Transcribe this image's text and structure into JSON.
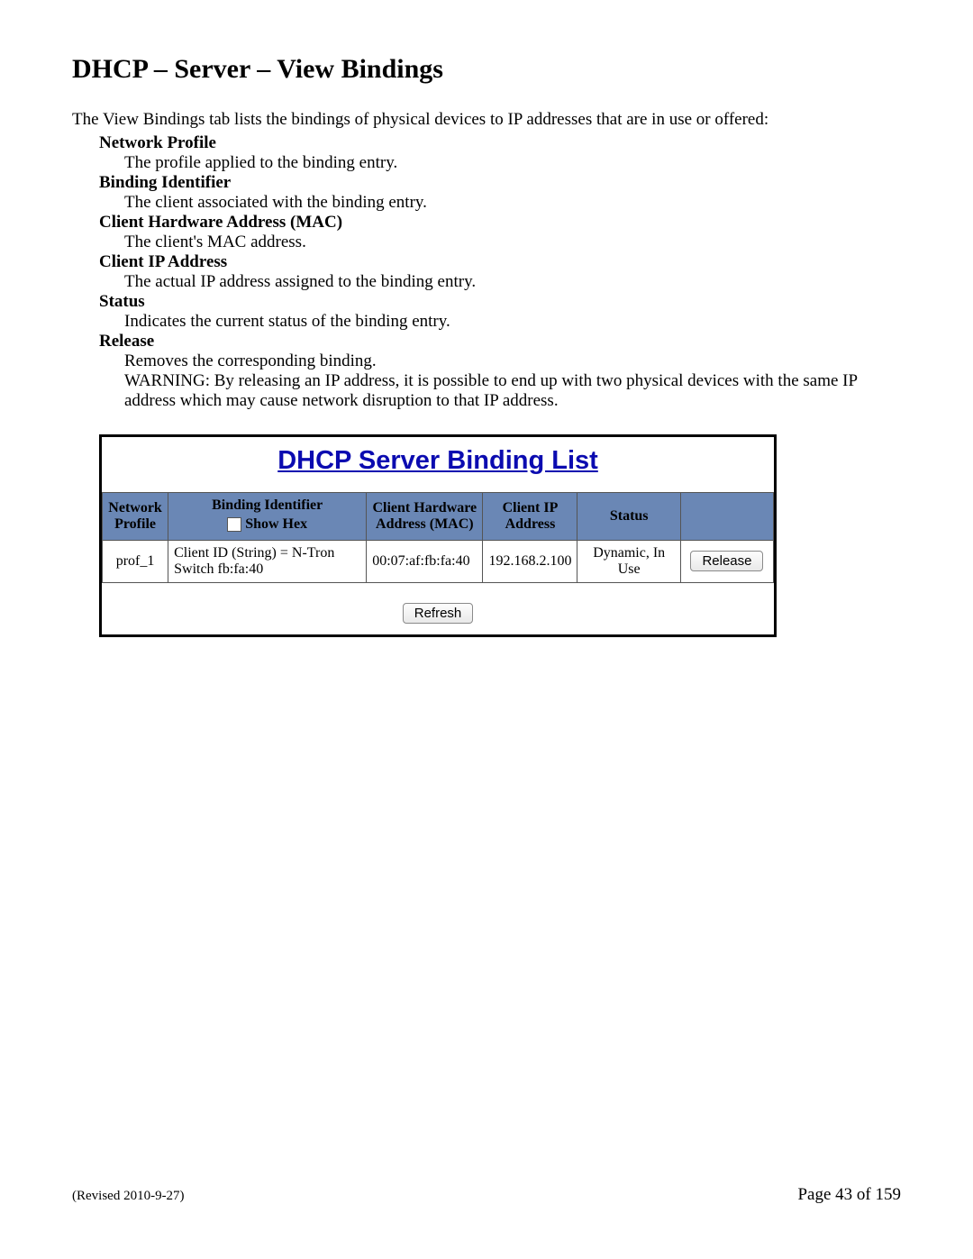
{
  "title": "DHCP – Server – View Bindings",
  "intro": "The View Bindings tab lists the bindings of physical devices to IP addresses that are in use or offered:",
  "definitions": [
    {
      "term": "Network Profile",
      "desc": "The profile applied to the binding entry."
    },
    {
      "term": "Binding Identifier",
      "desc": "The client associated with the binding entry."
    },
    {
      "term": "Client Hardware Address (MAC)",
      "desc": "The client's MAC address."
    },
    {
      "term": "Client IP Address",
      "desc": "The actual IP address assigned to the binding entry."
    },
    {
      "term": "Status",
      "desc": "Indicates the current status of the binding entry."
    },
    {
      "term": "Release",
      "desc": "Removes the corresponding binding.",
      "warning": "WARNING: By releasing an IP address, it is possible to end up with two physical devices with the same IP address which may cause network disruption to that IP address."
    }
  ],
  "panel": {
    "title": "DHCP Server Binding List",
    "headers": {
      "network_profile": "Network Profile",
      "binding_identifier": "Binding Identifier",
      "show_hex_label": "Show Hex",
      "client_mac": "Client Hardware Address (MAC)",
      "client_ip": "Client IP Address",
      "status": "Status",
      "actions": ""
    },
    "rows": [
      {
        "profile": "prof_1",
        "binding_id": "Client ID (String) = N-Tron Switch fb:fa:40",
        "mac": "00:07:af:fb:fa:40",
        "ip": "192.168.2.100",
        "status": "Dynamic, In Use",
        "release_label": "Release"
      }
    ],
    "refresh_label": "Refresh"
  },
  "footer": {
    "revised": "(Revised 2010-9-27)",
    "page": "Page 43 of 159"
  }
}
